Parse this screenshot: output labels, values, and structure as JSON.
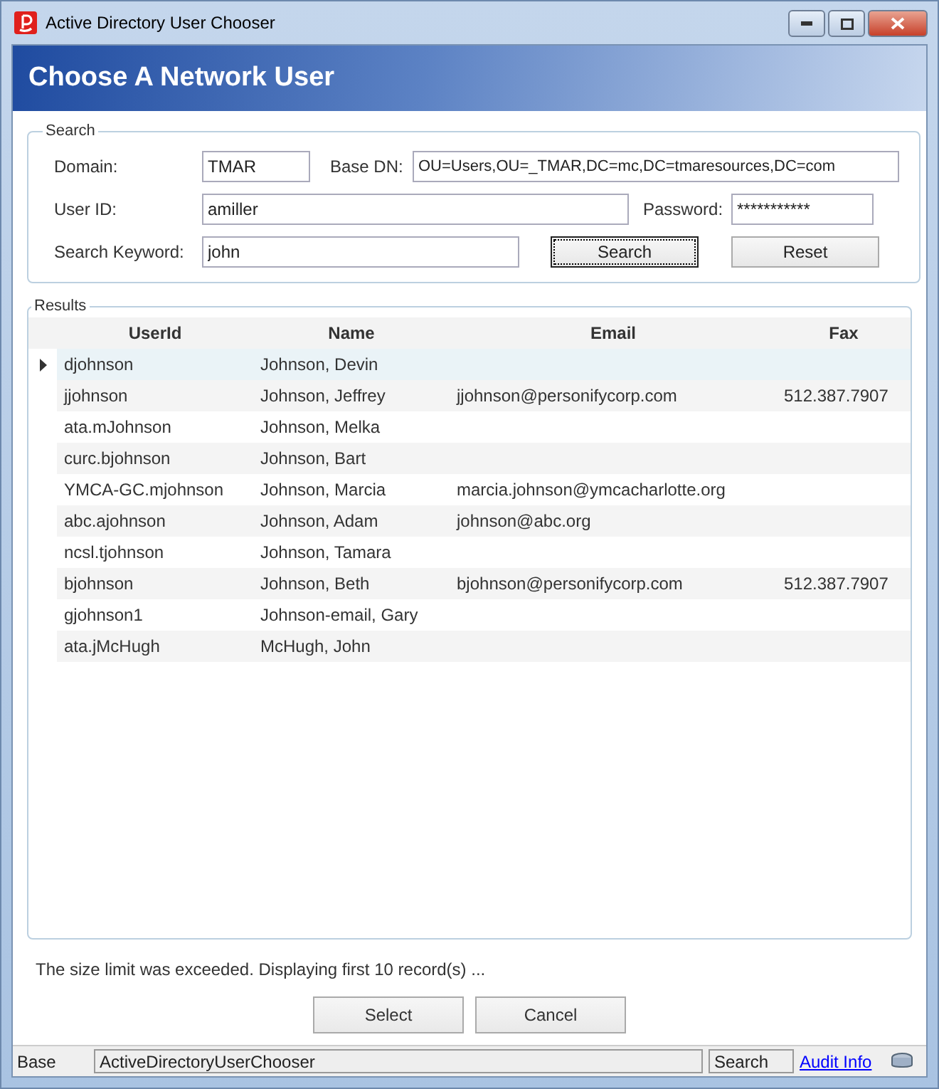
{
  "window": {
    "title": "Active Directory User Chooser"
  },
  "header": {
    "title": "Choose A Network User"
  },
  "search": {
    "legend": "Search",
    "domain": {
      "label": "Domain:",
      "value": "TMAR"
    },
    "base_dn": {
      "label": "Base DN:",
      "value": "OU=Users,OU=_TMAR,DC=mc,DC=tmaresources,DC=com"
    },
    "user_id": {
      "label": "User ID:",
      "value": "amiller"
    },
    "password": {
      "label": "Password:",
      "value": "***********"
    },
    "keyword": {
      "label": "Search Keyword:",
      "value": "john"
    },
    "buttons": [
      {
        "label": "Search",
        "focused": true
      },
      {
        "label": "Reset",
        "focused": false
      }
    ]
  },
  "results": {
    "legend": "Results",
    "columns": [
      "UserId",
      "Name",
      "Email",
      "Fax"
    ],
    "rows": [
      {
        "selected": true,
        "cells": [
          "djohnson",
          "Johnson, Devin",
          "",
          ""
        ]
      },
      {
        "selected": false,
        "cells": [
          "jjohnson",
          "Johnson, Jeffrey",
          "jjohnson@personifycorp.com",
          "512.387.7907"
        ]
      },
      {
        "selected": false,
        "cells": [
          "ata.mJohnson",
          "Johnson, Melka",
          "",
          ""
        ]
      },
      {
        "selected": false,
        "cells": [
          "curc.bjohnson",
          "Johnson, Bart",
          "",
          ""
        ]
      },
      {
        "selected": false,
        "cells": [
          "YMCA-GC.mjohnson",
          "Johnson, Marcia",
          "marcia.johnson@ymcacharlotte.org",
          ""
        ]
      },
      {
        "selected": false,
        "cells": [
          "abc.ajohnson",
          "Johnson, Adam",
          "johnson@abc.org",
          ""
        ]
      },
      {
        "selected": false,
        "cells": [
          "ncsl.tjohnson",
          "Johnson, Tamara",
          "",
          ""
        ]
      },
      {
        "selected": false,
        "cells": [
          "bjohnson",
          "Johnson, Beth",
          "bjohnson@personifycorp.com",
          "512.387.7907"
        ]
      },
      {
        "selected": false,
        "cells": [
          "gjohnson1",
          "Johnson-email, Gary",
          "",
          ""
        ]
      },
      {
        "selected": false,
        "cells": [
          "ata.jMcHugh",
          "McHugh, John",
          "",
          ""
        ]
      }
    ]
  },
  "message": "The size limit was exceeded. Displaying first 10 record(s) ...",
  "actions": [
    "Select",
    "Cancel"
  ],
  "status_bar": {
    "base": "Base",
    "form": "ActiveDirectoryUserChooser",
    "mode": "Search",
    "link": "Audit Info"
  }
}
